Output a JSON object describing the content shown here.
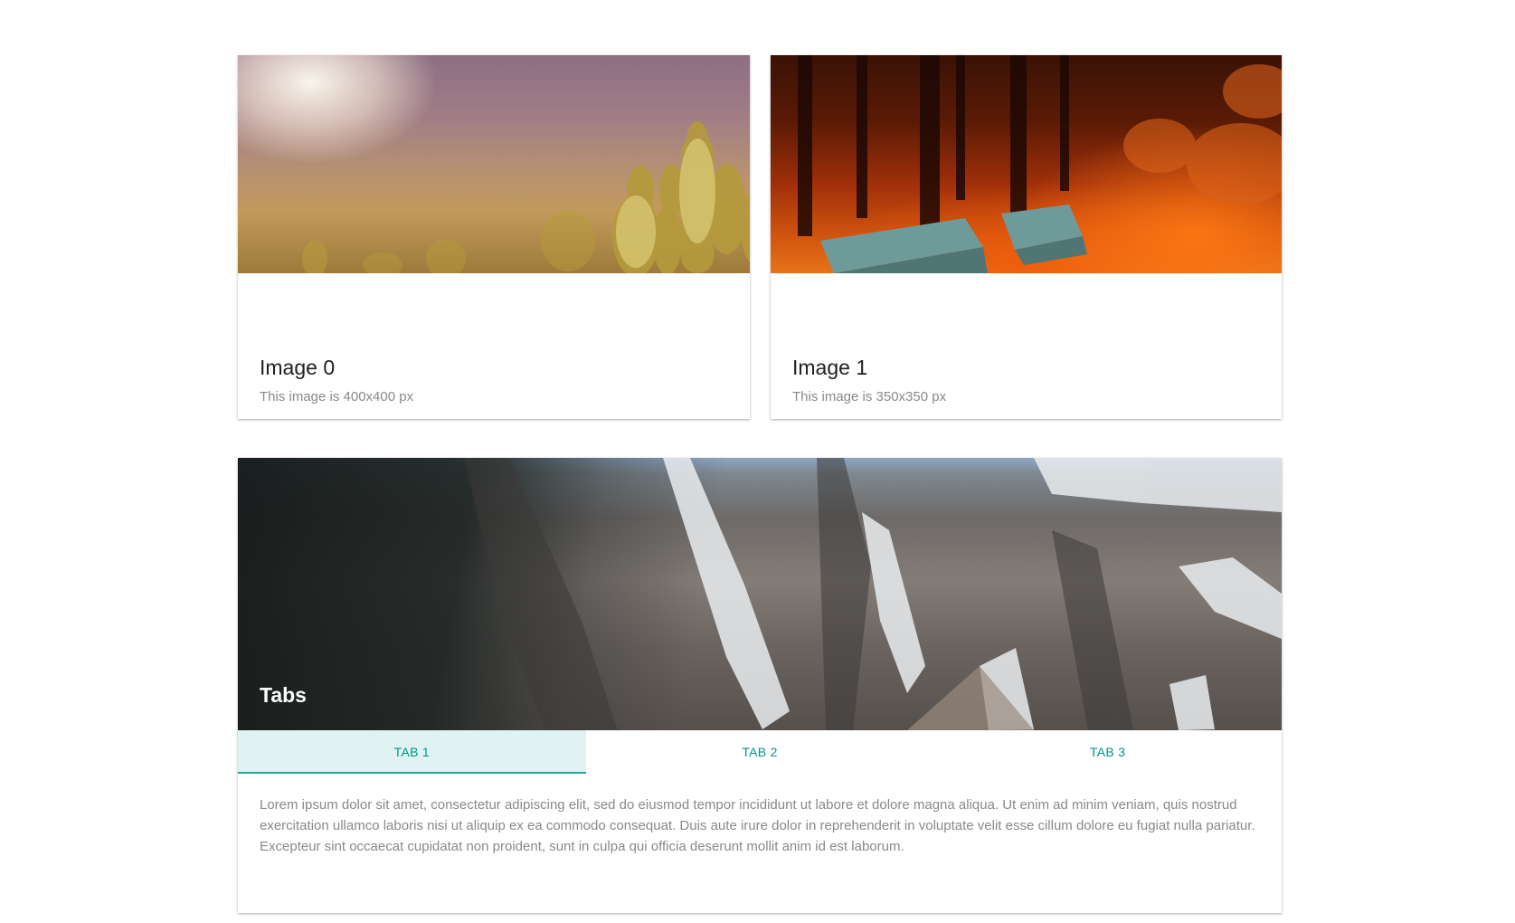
{
  "cards": [
    {
      "title": "Image 0",
      "subtitle": "This image is 400x400 px",
      "image_subject": "cactus-sunset-photo"
    },
    {
      "title": "Image 1",
      "subtitle": "This image is 350x350 px",
      "image_subject": "autumn-bench-photo"
    }
  ],
  "tabs_card": {
    "title": "Tabs",
    "image_subject": "mountain-cliffs-photo",
    "tabs": [
      {
        "label": "TAB 1",
        "active": true
      },
      {
        "label": "TAB 2",
        "active": false
      },
      {
        "label": "TAB 3",
        "active": false
      }
    ],
    "panel_text": "Lorem ipsum dolor sit amet, consectetur adipiscing elit, sed do eiusmod tempor incididunt ut labore et dolore magna aliqua. Ut enim ad minim veniam, quis nostrud exercitation ullamco laboris nisi ut aliquip ex ea commodo consequat. Duis aute irure dolor in reprehenderit in voluptate velit esse cillum dolore eu fugiat nulla pariatur. Excepteur sint occaecat cupidatat non proident, sunt in culpa qui officia deserunt mollit anim id est laborum."
  },
  "colors": {
    "accent": "#009688",
    "active_tab_bg": "#e0f2f1",
    "indicator": "#26a69a"
  }
}
